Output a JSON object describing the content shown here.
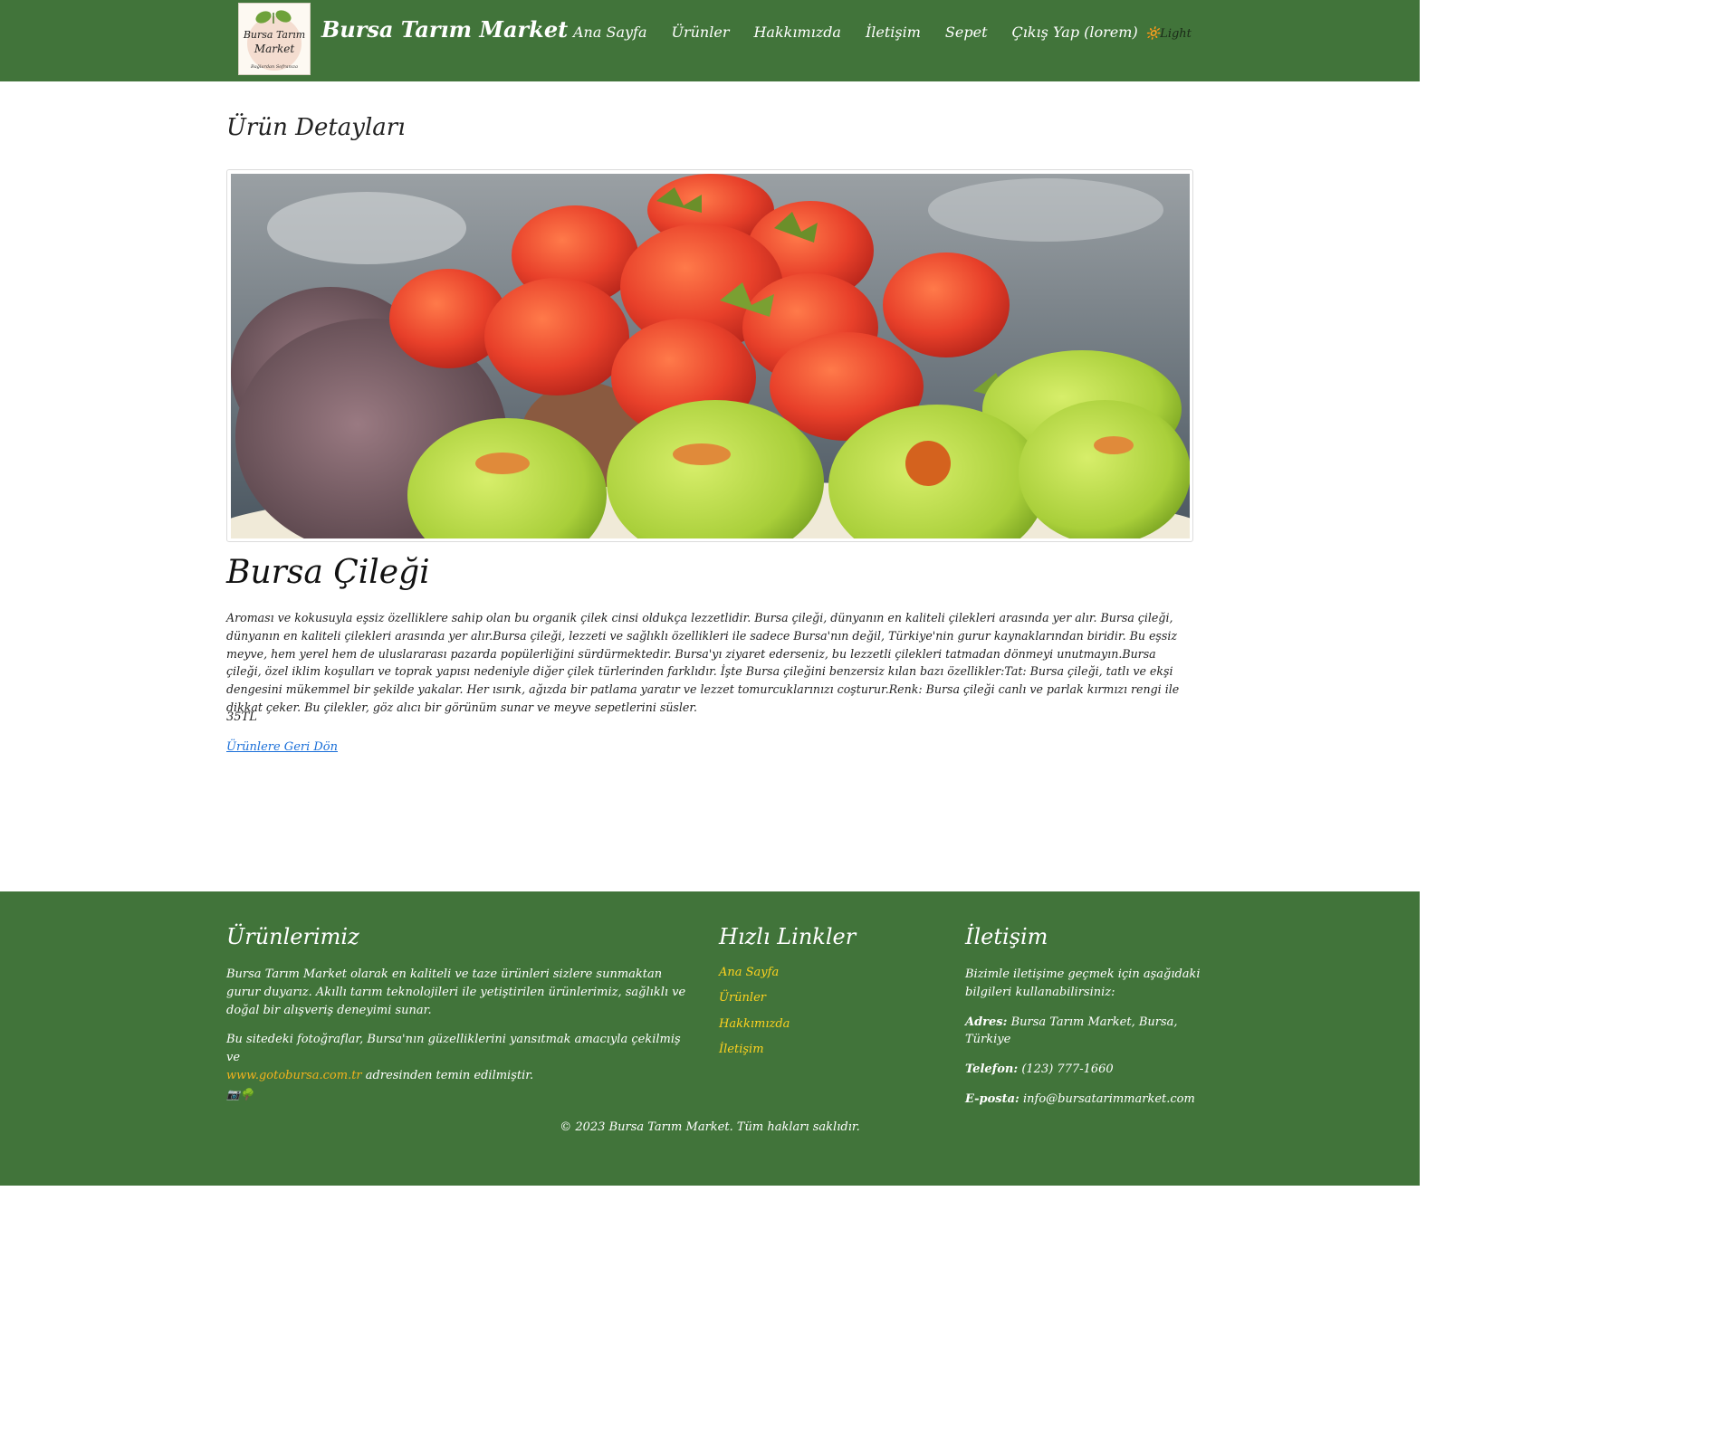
{
  "header": {
    "logo_line1": "Bursa Tarım",
    "logo_line2": "Market",
    "logo_tagline": "Bağlardan Sofranıza",
    "brand": "Bursa Tarım Market",
    "nav": [
      {
        "label": "Ana Sayfa"
      },
      {
        "label": "Ürünler"
      },
      {
        "label": "Hakkımızda"
      },
      {
        "label": "İletişim"
      },
      {
        "label": "Sepet"
      },
      {
        "label": "Çıkış Yap (lorem)"
      }
    ],
    "theme_toggle": "🔆Light"
  },
  "main": {
    "heading": "Ürün Detayları",
    "product": {
      "name": "Bursa Çileği",
      "description": "Aroması ve kokusuyla eşsiz özelliklere sahip olan bu organik çilek cinsi oldukça lezzetlidir. Bursa çileği, dünyanın en kaliteli çilekleri arasında yer alır. Bursa çileği, dünyanın en kaliteli çilekleri arasında yer alır.Bursa çileği, lezzeti ve sağlıklı özellikleri ile sadece Bursa'nın değil, Türkiye'nin gurur kaynaklarından biridir. Bu eşsiz meyve, hem yerel hem de uluslararası pazarda popülerliğini sürdürmektedir. Bursa'yı ziyaret ederseniz, bu lezzetli çilekleri tatmadan dönmeyi unutmayın.Bursa çileği, özel iklim koşulları ve toprak yapısı nedeniyle diğer çilek türlerinden farklıdır. İşte Bursa çileğini benzersiz kılan bazı özellikler:Tat: Bursa çileği, tatlı ve ekşi dengesini mükemmel bir şekilde yakalar. Her ısırık, ağızda bir patlama yaratır ve lezzet tomurcuklarınızı coşturur.Renk: Bursa çileği canlı ve parlak kırmızı rengi ile dikkat çeker. Bu çilekler, göz alıcı bir görünüm sunar ve meyve sepetlerini süsler.",
      "price": "35TL",
      "back_link": "Ürünlere Geri Dön"
    }
  },
  "footer": {
    "products": {
      "title": "Ürünlerimiz",
      "text1": "Bursa Tarım Market olarak en kaliteli ve taze ürünleri sizlere sunmaktan gurur duyarız. Akıllı tarım teknolojileri ile yetiştirilen ürünlerimiz, sağlıklı ve doğal bir alışveriş deneyimi sunar.",
      "text2_before": "Bu sitedeki fotoğraflar, Bursa'nın güzelliklerini yansıtmak amacıyla çekilmiş ve",
      "text2_link": "www.gotobursa.com.tr",
      "text2_after": "adresinden temin edilmiştir.",
      "emojis": "📷🌳"
    },
    "quick_links": {
      "title": "Hızlı Linkler",
      "items": [
        "Ana Sayfa",
        "Ürünler",
        "Hakkımızda",
        "İletişim"
      ]
    },
    "contact": {
      "title": "İletişim",
      "intro": "Bizimle iletişime geçmek için aşağıdaki bilgileri kullanabilirsiniz:",
      "address_label": "Adres:",
      "address": "Bursa Tarım Market, Bursa, Türkiye",
      "phone_label": "Telefon:",
      "phone": "(123) 777-1660",
      "email_label": "E-posta:",
      "email": "info@bursatarimmarket.com"
    },
    "copyright": "© 2023 Bursa Tarım Market. Tüm hakları saklıdır."
  },
  "colors": {
    "brand_green": "#41743a",
    "link_yellow": "#ffd21f",
    "link_blue": "#1a6fd8"
  }
}
